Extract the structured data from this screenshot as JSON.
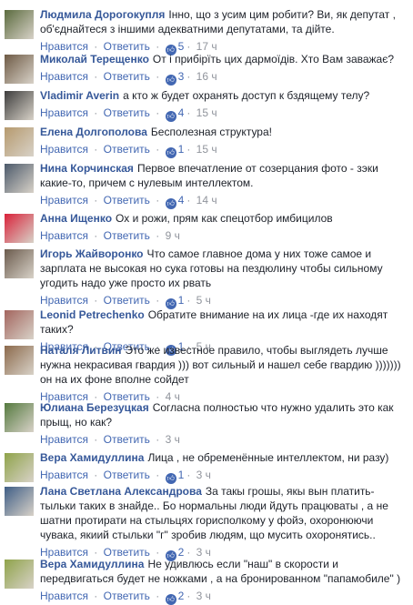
{
  "common": {
    "like_label": "Нравится",
    "reply_label": "Ответить",
    "separator": "·",
    "like_icon": "thumbs-up-icon"
  },
  "comments": [
    {
      "author": "Людмила Дорогокупля",
      "text": "Інно, що з усим цим робити? Ви, як депутат , об'єднайтеся з іншими адекватними депутатами, та дійте.",
      "likes": "5",
      "time": "17 ч",
      "avatar_color": "#5b6b3e"
    },
    {
      "author": "Миколай Терещенко",
      "text": "От і прибірїть цих дармоїдів. Хто Вам заважає?",
      "likes": "3",
      "time": "16 ч",
      "avatar_color": "#6e5a45"
    },
    {
      "author": "Vladimir Averin",
      "text": "а кто ж будет охранять доступ к бздящему телу?",
      "likes": "4",
      "time": "15 ч",
      "avatar_color": "#3d3d3d"
    },
    {
      "author": "Елена Долгополова",
      "text": "Бесполезная структура!",
      "likes": "1",
      "time": "15 ч",
      "avatar_color": "#b69a6e"
    },
    {
      "author": "Нина Корчинская",
      "text": "Первое впечатление от созерцания фото - зэки какие-то, причем с нулевым интеллектом.",
      "likes": "4",
      "time": "14 ч",
      "avatar_color": "#4c5a6b"
    },
    {
      "author": "Анна Ищенко",
      "text": "Ох и рожи, прям как спецотбор имбицилов",
      "likes": "",
      "time": "9 ч",
      "avatar_color": "#d9223a"
    },
    {
      "author": "Игорь Жайворонко",
      "text": "Что самое главное дома у них тоже самое и зарплата не высокая но сука готовы на пездюлину чтобы сильному угодить надо уже просто их рвать",
      "likes": "1",
      "time": "5 ч",
      "avatar_color": "#6b5b4d"
    },
    {
      "author": "Leonid Petrechenko",
      "text": "Обратите внимание на их лица -где их находят таких?",
      "likes": "1",
      "time": "5 ч",
      "avatar_color": "#a3655e"
    },
    {
      "author": "Наталя Литвин",
      "text": "Это же известное правило, чтобы выглядеть лучше нужна некрасивая гвардия ))) вот сильный и нашел себе гвардию ))))))) он на их фоне вполне сойдет",
      "likes": "",
      "time": "4 ч",
      "avatar_color": "#8c6a4c"
    },
    {
      "author": "Юлиана Березуцкая",
      "text": "Согласна полностью что нужно удалить это как прыщ, но как?",
      "likes": "",
      "time": "3 ч",
      "avatar_color": "#557a3f"
    },
    {
      "author": "Вера Хамидуллина",
      "text": "Лица , не обременённые интеллектом, ни разу)",
      "likes": "1",
      "time": "3 ч",
      "avatar_color": "#8fa34a"
    },
    {
      "author": "Лана Светлана Александрова",
      "text": "За такы грошы, якы вын платить- тыльки таких в знайде.. Бо нормальны люди йдуть працюваты , а не шатни протирати на стыльцях горисполкому у фойэ, охоронюючи чувака, якиий стыльки \"г\" зробив людям, що мусить охоронятись..",
      "likes": "2",
      "time": "3 ч",
      "avatar_color": "#3f5e86"
    },
    {
      "author": "Вера Хамидуллина",
      "text": "Не удивлюсь если \"наш\" в скорости и передвигаться будет не ножками , а на бронированном \"папамобиле\" )",
      "likes": "2",
      "time": "3 ч",
      "avatar_color": "#8fa34a"
    }
  ]
}
